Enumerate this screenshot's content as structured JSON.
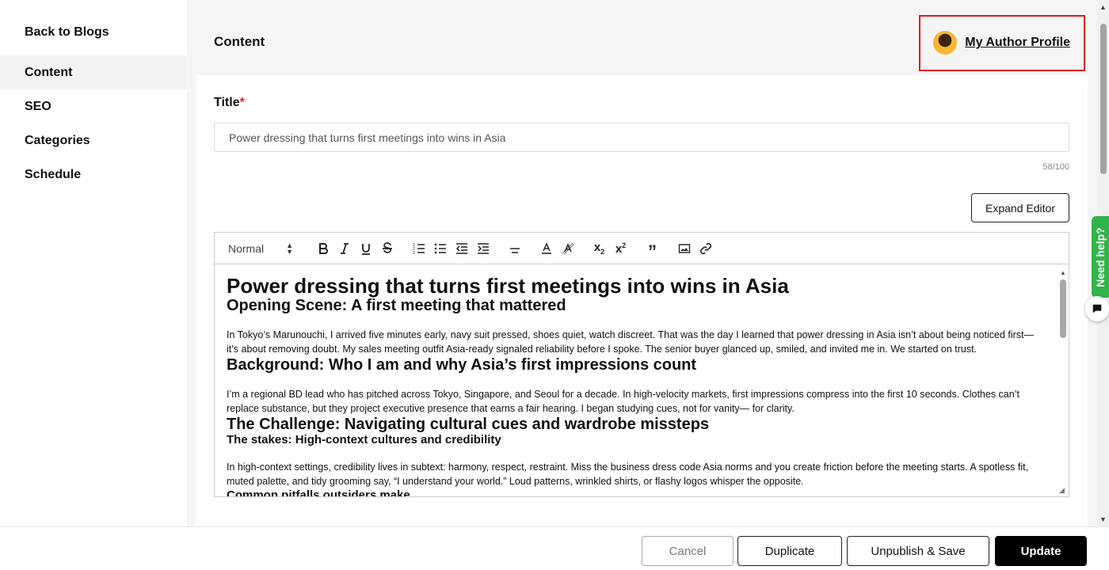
{
  "sidebar": {
    "back_label": "Back to Blogs",
    "items": [
      {
        "label": "Content"
      },
      {
        "label": "SEO"
      },
      {
        "label": "Categories"
      },
      {
        "label": "Schedule"
      }
    ]
  },
  "header": {
    "title": "Content",
    "author_link": "My Author Profile"
  },
  "form": {
    "title_label": "Title",
    "required_mark": "*",
    "title_value": "Power dressing that turns first meetings into wins in Asia",
    "char_count": "58/100",
    "expand_label": "Expand Editor"
  },
  "toolbar": {
    "format_select": "Normal",
    "icons": [
      "bold-icon",
      "italic-icon",
      "underline-icon",
      "strikethrough-icon",
      "ordered-list-icon",
      "bullet-list-icon",
      "outdent-icon",
      "indent-icon",
      "align-icon",
      "text-color-icon",
      "highlight-icon",
      "subscript-icon",
      "superscript-icon",
      "blockquote-icon",
      "image-icon",
      "link-icon"
    ]
  },
  "editor": {
    "h1": "Power dressing that turns first meetings into wins in Asia",
    "h2_1": "Opening Scene: A first meeting that mattered",
    "p1": "In Tokyo’s Marunouchi, I arrived five minutes early, navy suit pressed, shoes quiet, watch discreet. That was the day I learned that power dressing in Asia isn’t about being noticed first—it’s about removing doubt. My sales meeting outfit Asia-ready signaled reliability before I spoke. The senior buyer glanced up, smiled, and invited me in. We started on trust.",
    "h2_2": "Background: Who I am and why Asia’s first impressions count",
    "p2": "I’m a regional BD lead who has pitched across Tokyo, Singapore, and Seoul for a decade. In high-velocity markets, first impressions compress into the first 10 seconds. Clothes can’t replace substance, but they project executive presence that earns a fair hearing. I began studying cues, not for vanity— for clarity.",
    "h2_3": "The Challenge: Navigating cultural cues and wardrobe missteps",
    "h3_1": "The stakes: High-context cultures and credibility",
    "p3": "In high-context settings, credibility lives in subtext: harmony, respect, restraint. Miss the business dress code Asia norms and you create friction before the meeting starts. A spotless fit, muted palette, and tidy grooming say, “I understand your world.” Loud patterns, wrinkled shirts, or flashy logos whisper the opposite.",
    "h3_2": "Common pitfalls outsiders make"
  },
  "help": {
    "label": "Need help?"
  },
  "footer": {
    "cancel": "Cancel",
    "duplicate": "Duplicate",
    "unpublish": "Unpublish & Save",
    "update": "Update"
  },
  "colors": {
    "required": "#d02828",
    "highlight_border": "#e01b1b",
    "help_tab": "#2fb54a",
    "primary_button": "#000000"
  }
}
